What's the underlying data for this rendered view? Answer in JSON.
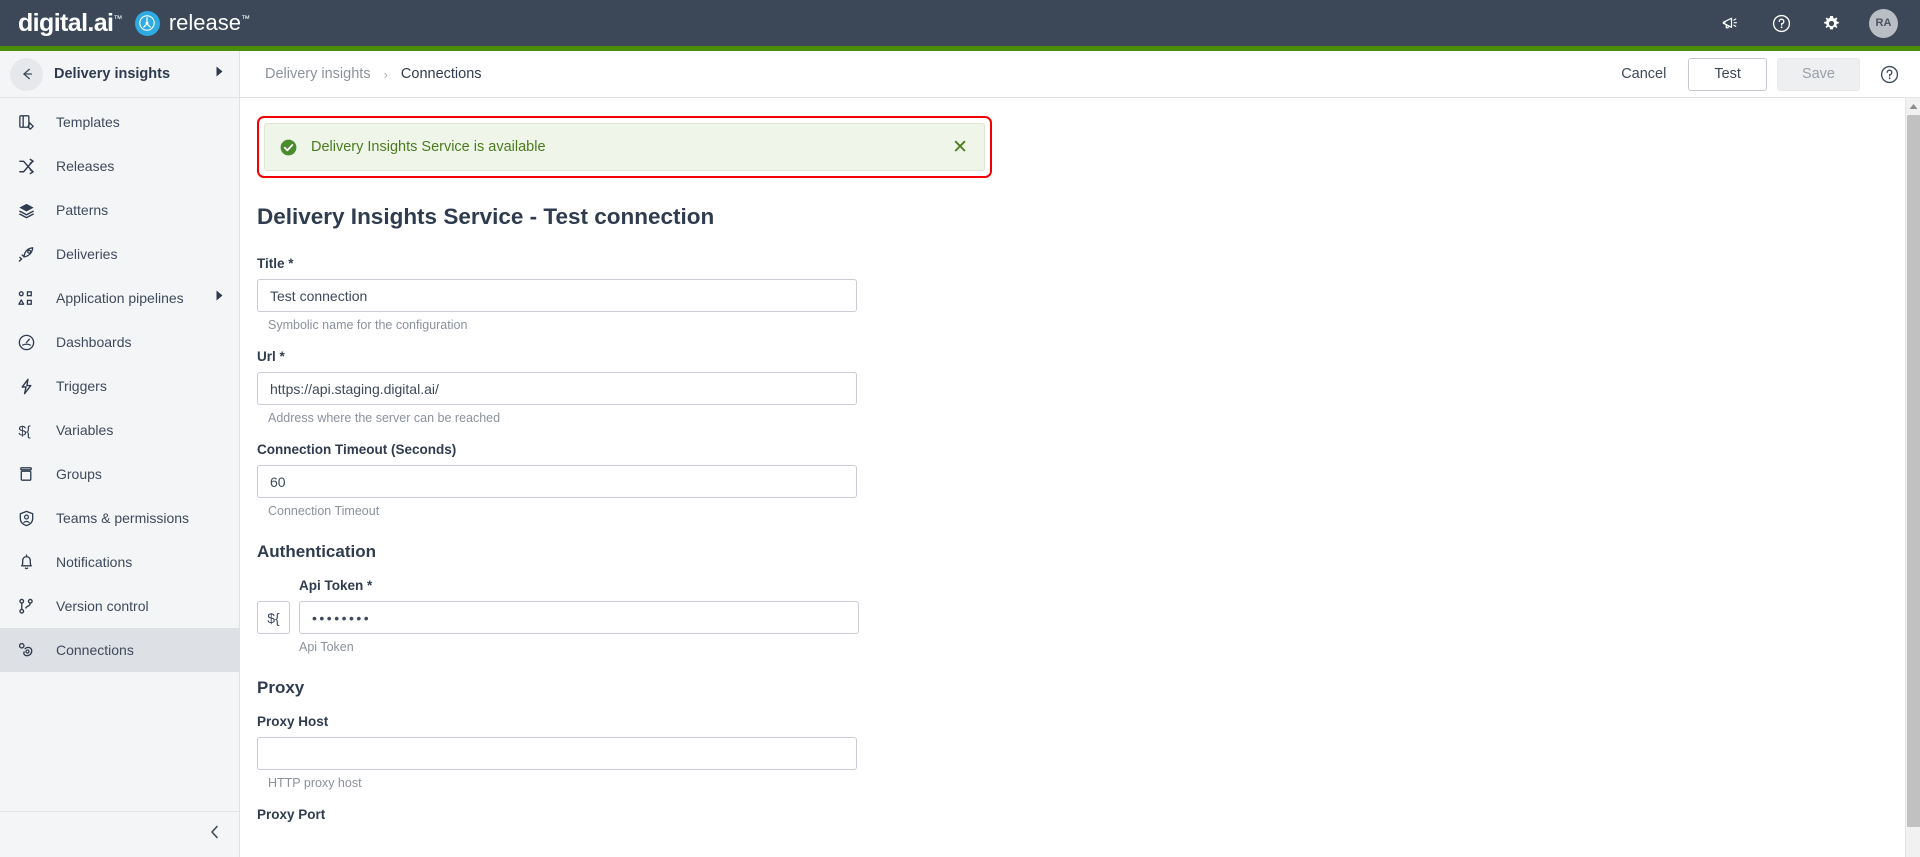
{
  "brand": {
    "digital_ai": "digital.ai",
    "product": "release",
    "trademark": "™"
  },
  "topbar": {
    "icons": [
      {
        "name": "announcements-icon",
        "label": "Announcements"
      },
      {
        "name": "help-icon",
        "label": "Help"
      },
      {
        "name": "settings-gear-icon",
        "label": "Settings"
      }
    ],
    "avatar_initials": "RA",
    "accent_color": "#4c8c0b",
    "background_color": "#3c4858"
  },
  "sidebar": {
    "header_label": "Delivery insights",
    "has_back_arrow": true,
    "has_expand_arrow": true,
    "items": [
      {
        "label": "Templates",
        "icon": "templates-icon",
        "active": false,
        "expandable": false
      },
      {
        "label": "Releases",
        "icon": "releases-shuffle-icon",
        "active": false,
        "expandable": false
      },
      {
        "label": "Patterns",
        "icon": "patterns-layers-icon",
        "active": false,
        "expandable": false
      },
      {
        "label": "Deliveries",
        "icon": "deliveries-rocket-icon",
        "active": false,
        "expandable": false
      },
      {
        "label": "Application pipelines",
        "icon": "application-pipelines-icon",
        "active": false,
        "expandable": true
      },
      {
        "label": "Dashboards",
        "icon": "dashboards-gauge-icon",
        "active": false,
        "expandable": false
      },
      {
        "label": "Triggers",
        "icon": "triggers-bolt-icon",
        "active": false,
        "expandable": false
      },
      {
        "label": "Variables",
        "icon": "variables-icon",
        "active": false,
        "expandable": false
      },
      {
        "label": "Groups",
        "icon": "groups-box-icon",
        "active": false,
        "expandable": false
      },
      {
        "label": "Teams & permissions",
        "icon": "teams-permissions-icon",
        "active": false,
        "expandable": false
      },
      {
        "label": "Notifications",
        "icon": "notifications-bell-icon",
        "active": false,
        "expandable": false
      },
      {
        "label": "Version control",
        "icon": "version-control-branch-icon",
        "active": false,
        "expandable": false
      },
      {
        "label": "Connections",
        "icon": "connections-plug-icon",
        "active": true,
        "expandable": false
      }
    ],
    "collapse_label": "Collapse sidebar"
  },
  "page_header": {
    "breadcrumb": {
      "parent": "Delivery insights",
      "separator": "›",
      "current": "Connections"
    },
    "actions": {
      "cancel": "Cancel",
      "test": "Test",
      "save": "Save",
      "save_disabled": true,
      "help_icon": "help-circle-icon"
    }
  },
  "alert": {
    "message": "Delivery Insights Service is available",
    "type": "success",
    "icon": "check-circle-icon",
    "close_label": "✕",
    "highlight_border_color": "#f40000",
    "background_color": "#f0f5e9",
    "text_color": "#4a7c1f"
  },
  "form": {
    "title": "Delivery Insights Service - Test connection",
    "fields": [
      {
        "label": "Title",
        "required": true,
        "value": "Test connection",
        "hint": "Symbolic name for the configuration",
        "type": "text"
      },
      {
        "label": "Url",
        "required": true,
        "value": "https://api.staging.digital.ai/",
        "hint": "Address where the server can be reached",
        "type": "text"
      },
      {
        "label": "Connection Timeout (Seconds)",
        "required": false,
        "value": "60",
        "hint": "Connection Timeout",
        "type": "number"
      }
    ],
    "authentication": {
      "section_title": "Authentication",
      "field": {
        "label": "Api Token",
        "required": true,
        "value": "••••••••",
        "hint": "Api Token",
        "type": "password",
        "variable_button": "${"
      }
    },
    "proxy": {
      "section_title": "Proxy",
      "fields": [
        {
          "label": "Proxy Host",
          "required": false,
          "value": "",
          "hint": "HTTP proxy host",
          "type": "text"
        },
        {
          "label": "Proxy Port",
          "required": false,
          "value": "",
          "hint": "",
          "type": "text"
        }
      ]
    }
  },
  "scrollbar": {
    "orientation": "vertical",
    "up_arrow": "▲"
  }
}
